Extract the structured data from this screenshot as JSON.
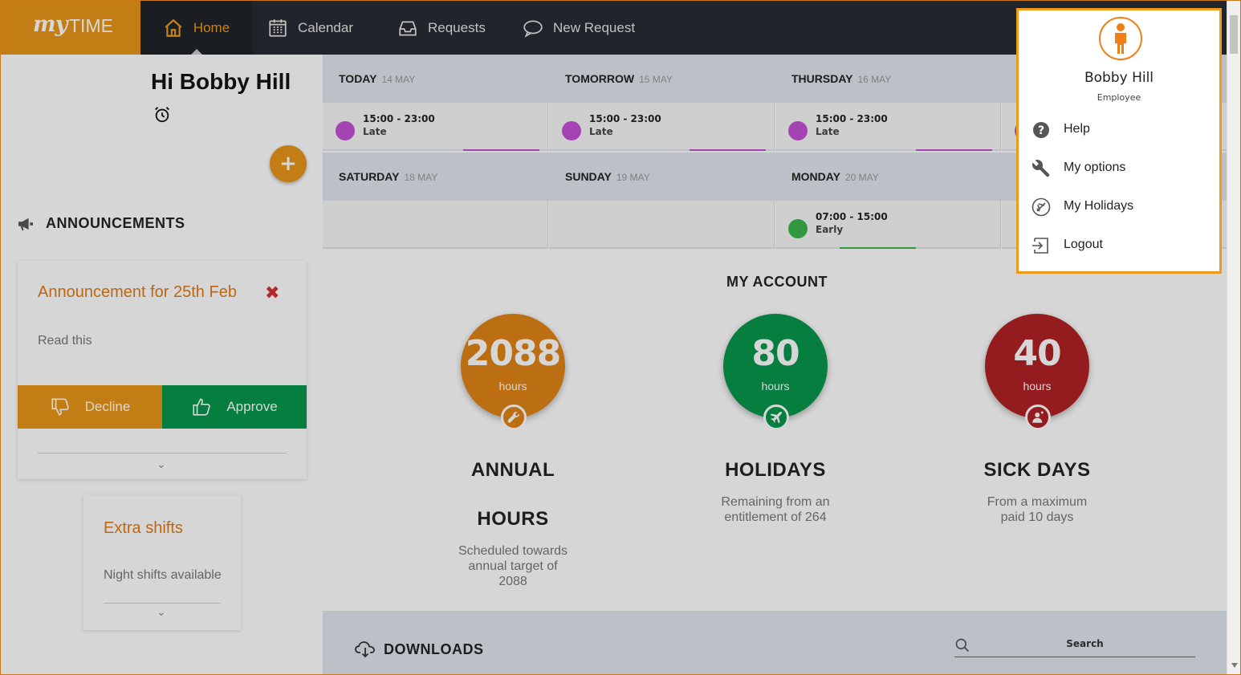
{
  "app": {
    "logo_my": "my",
    "logo_time": "TIME",
    "brand_color": "#e89518"
  },
  "nav": {
    "items": [
      {
        "label": "Home",
        "icon": "home-icon",
        "active": true
      },
      {
        "label": "Calendar",
        "icon": "calendar-icon"
      },
      {
        "label": "Requests",
        "icon": "inbox-icon"
      },
      {
        "label": "New Request",
        "icon": "chat-bubble-icon"
      }
    ]
  },
  "greeting": "Hi Bobby Hill",
  "add_button": "+",
  "announcements": {
    "title": "ANNOUNCEMENTS",
    "card": {
      "title": "Announcement for 25th Feb",
      "text": "Read this",
      "decline_label": "Decline",
      "approve_label": "Approve"
    },
    "extra": {
      "title": "Extra shifts",
      "text": "Night shifts available"
    }
  },
  "schedule": {
    "days": [
      {
        "name": "TODAY",
        "date": "14 MAY",
        "shift": {
          "time": "15:00 - 23:00",
          "type": "Late",
          "color": "#c64fd6"
        }
      },
      {
        "name": "TOMORROW",
        "date": "15 MAY",
        "shift": {
          "time": "15:00 - 23:00",
          "type": "Late",
          "color": "#c64fd6"
        }
      },
      {
        "name": "THURSDAY",
        "date": "16 MAY",
        "shift": {
          "time": "15:00 - 23:00",
          "type": "Late",
          "color": "#c64fd6"
        }
      },
      {
        "name": "SATURDAY",
        "date": "18 MAY",
        "shift": null
      },
      {
        "name": "SUNDAY",
        "date": "19 MAY",
        "shift": null
      },
      {
        "name": "MONDAY",
        "date": "20 MAY",
        "shift": {
          "time": "07:00 - 15:00",
          "type": "Early",
          "color": "#3ab54a"
        }
      }
    ]
  },
  "account": {
    "title": "MY ACCOUNT",
    "stats": [
      {
        "value": "2088",
        "unit": "hours",
        "label": "ANNUAL HOURS",
        "desc": "Scheduled towards annual target of 2088",
        "color": "#e08315",
        "icon": "wrench-icon"
      },
      {
        "value": "80",
        "unit": "hours",
        "label": "HOLIDAYS",
        "desc": "Remaining from an entitlement of 264",
        "color": "#05964a",
        "icon": "plane-icon"
      },
      {
        "value": "40",
        "unit": "hours",
        "label": "SICK DAYS",
        "desc": "From a maximum paid 10 days",
        "color": "#b02024",
        "icon": "sick-person-icon"
      }
    ]
  },
  "downloads": {
    "title": "DOWNLOADS",
    "search_placeholder": "Search"
  },
  "user_menu": {
    "name": "Bobby Hill",
    "role": "Employee",
    "items": [
      {
        "label": "Help",
        "icon": "help-icon"
      },
      {
        "label": "My options",
        "icon": "wrench-icon"
      },
      {
        "label": "My Holidays",
        "icon": "plane-circle-icon"
      },
      {
        "label": "Logout",
        "icon": "logout-icon"
      }
    ]
  }
}
